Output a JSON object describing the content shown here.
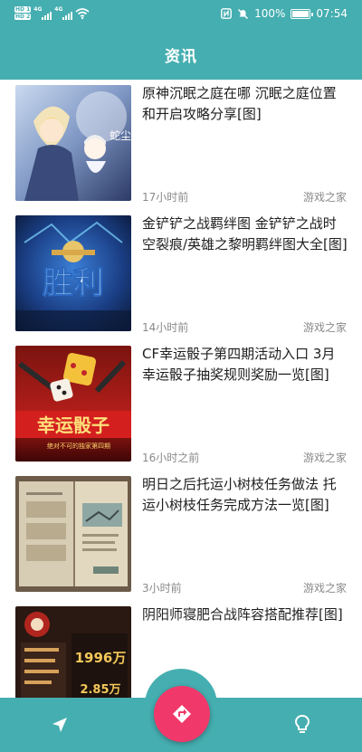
{
  "status_bar": {
    "sim1": "HD 1",
    "sim2": "HD 2",
    "net1": "4G",
    "net2": "4G",
    "battery_percent": "100%",
    "battery_level": 1.0,
    "time": "07:54",
    "icons": [
      "nfc-icon",
      "mute-icon",
      "battery-icon",
      "wifi-icon",
      "signal-icon"
    ]
  },
  "header": {
    "title": "资讯"
  },
  "articles": [
    {
      "title": "原神沉眠之庭在哪 沉眠之庭位置和开启攻略分享[图]",
      "time": "17小时前",
      "source": "游戏之家",
      "thumb_text": "蛇尘"
    },
    {
      "title": "金铲铲之战羁绊图 金铲铲之战时空裂痕/英雄之黎明羁绊图大全[图]",
      "time": "14小时前",
      "source": "游戏之家",
      "thumb_text": "胜利"
    },
    {
      "title": "CF幸运骰子第四期活动入口 3月幸运骰子抽奖规则奖励一览[图]",
      "time": "16小时之前",
      "source": "游戏之家",
      "thumb_text": "幸运骰子",
      "thumb_sub": "绝对不可的独家第四期"
    },
    {
      "title": "明日之后托运小树枝任务做法 托运小树枝任务完成方法一览[图]",
      "time": "3小时前",
      "source": "游戏之家",
      "thumb_text": ""
    },
    {
      "title": "阴阳师寝肥合战阵容搭配推荐[图]",
      "time": "",
      "source": "",
      "thumb_text": "1996万",
      "thumb_sub": "2.85万"
    }
  ],
  "bottom_nav": {
    "left_icon": "navigation-arrow-icon",
    "fab_icon": "directions-icon",
    "right_icon": "lightbulb-icon"
  },
  "colors": {
    "primary": "#45aeb0",
    "accent": "#f0396a"
  }
}
